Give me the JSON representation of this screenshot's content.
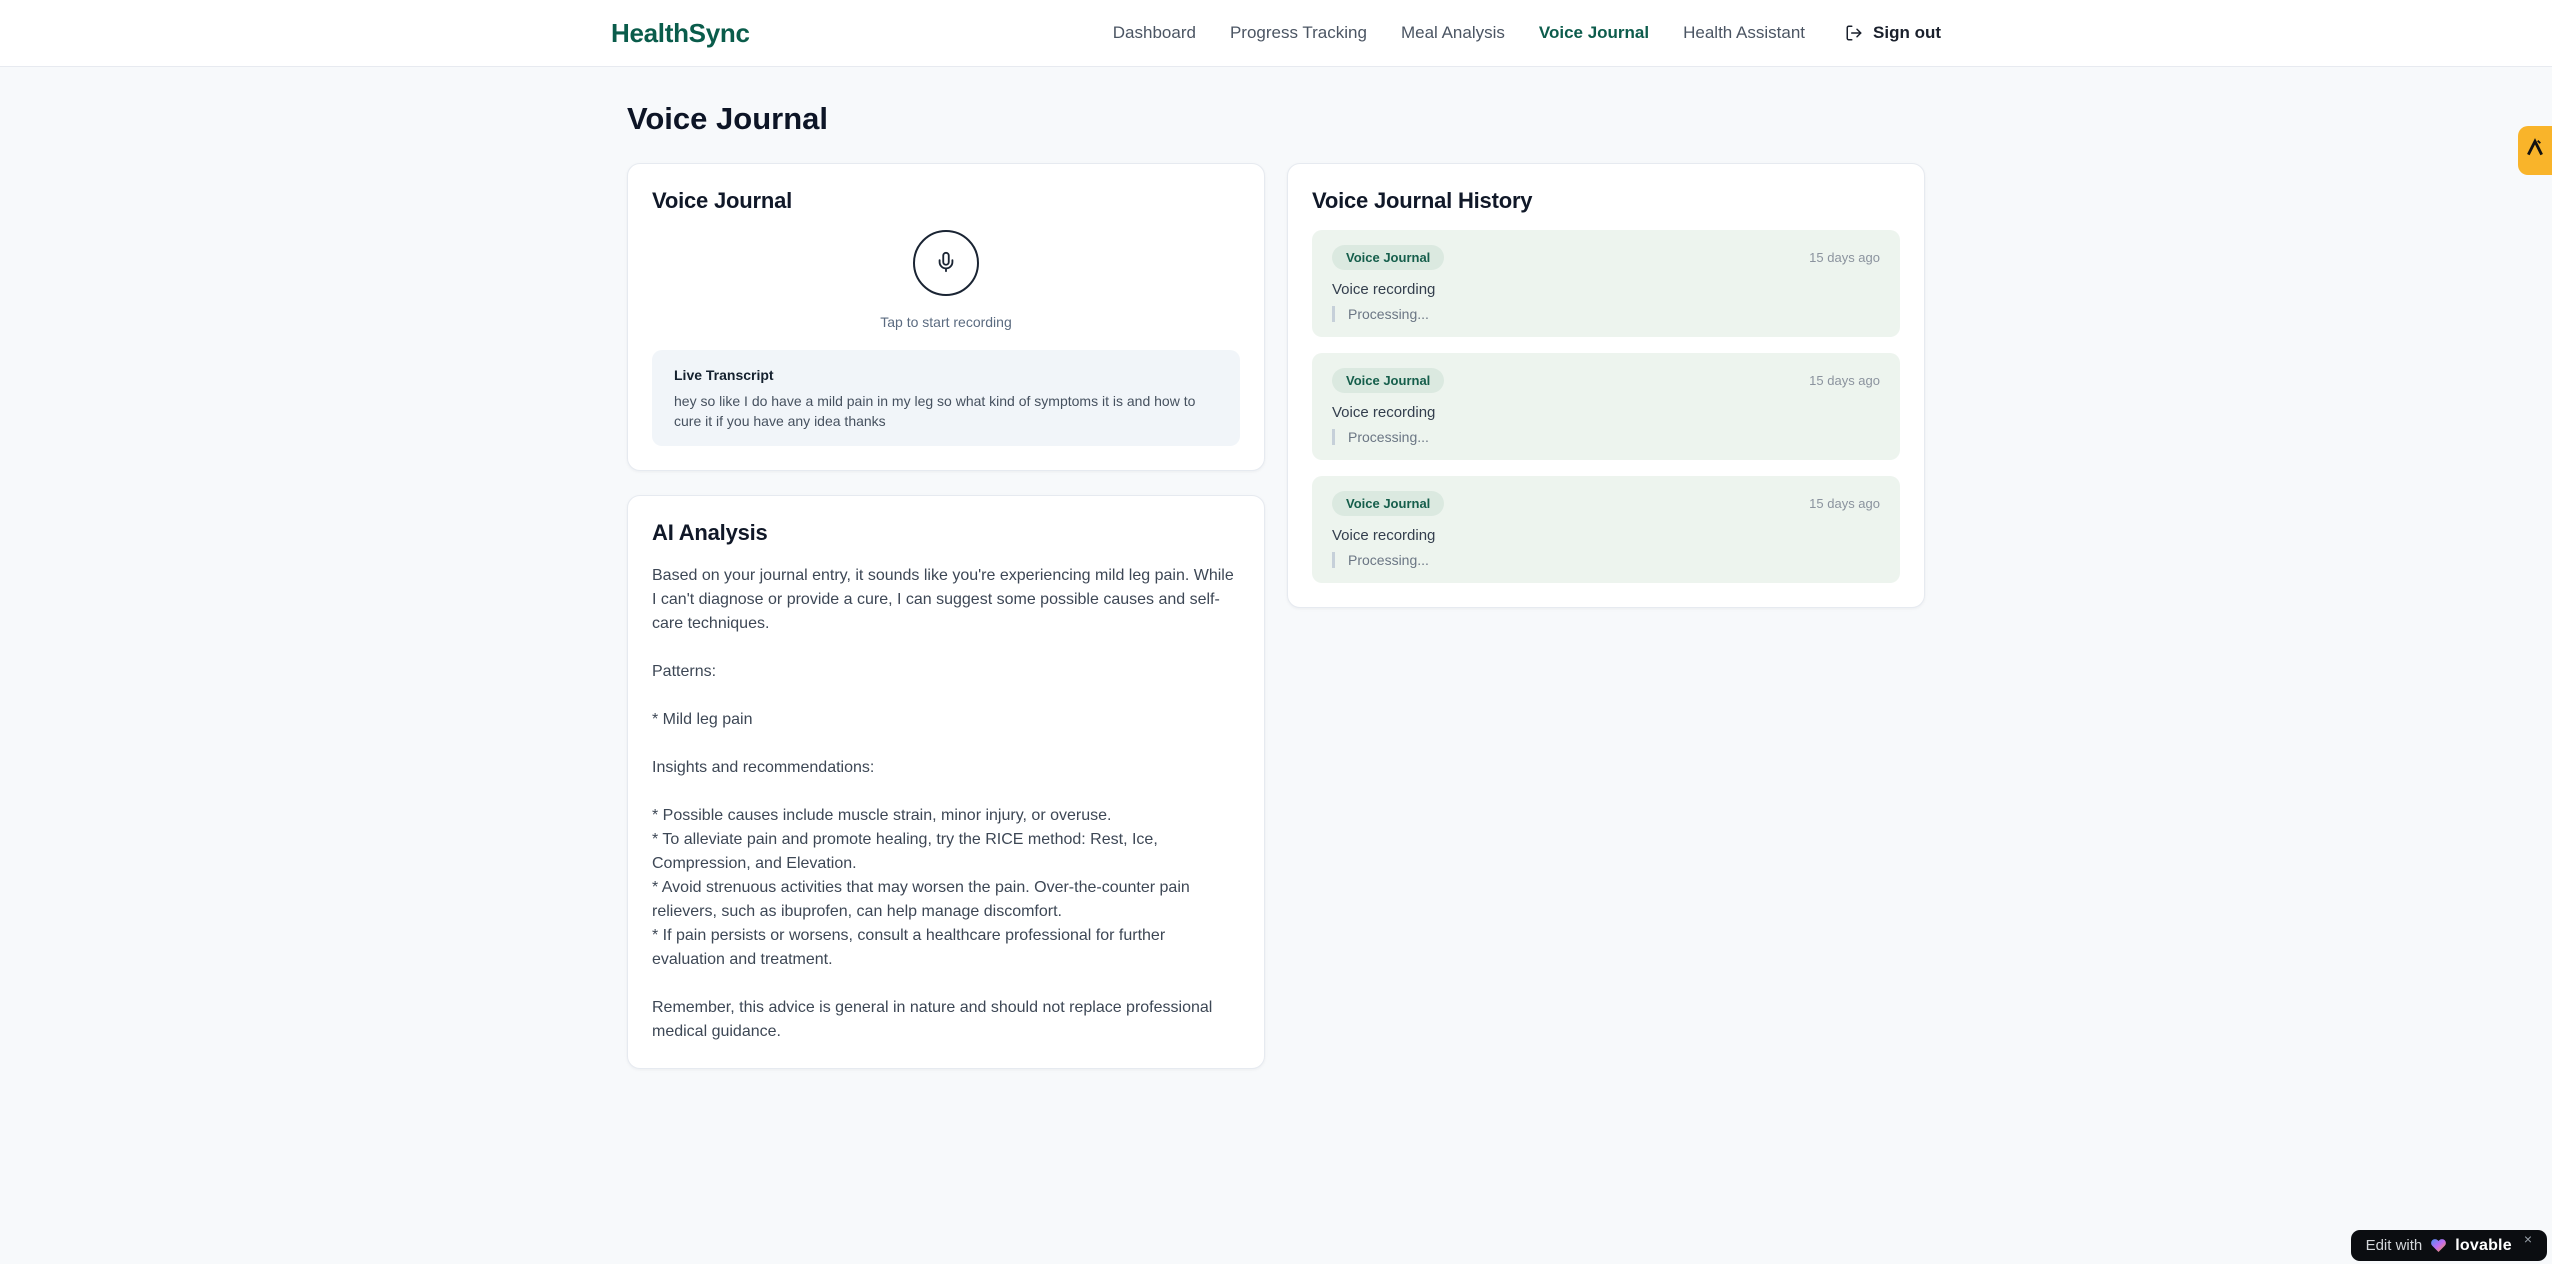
{
  "brand": {
    "name": "HealthSync"
  },
  "nav": {
    "items": [
      {
        "label": "Dashboard",
        "active": false
      },
      {
        "label": "Progress Tracking",
        "active": false
      },
      {
        "label": "Meal Analysis",
        "active": false
      },
      {
        "label": "Voice Journal",
        "active": true
      },
      {
        "label": "Health Assistant",
        "active": false
      }
    ],
    "sign_out": "Sign out"
  },
  "page": {
    "title": "Voice Journal"
  },
  "recorder": {
    "title": "Voice Journal",
    "hint": "Tap to start recording",
    "transcript_title": "Live Transcript",
    "transcript_text": "hey so like I do have a mild pain in my leg so what kind of symptoms it is and how to cure it if you have any idea thanks"
  },
  "analysis": {
    "title": "AI Analysis",
    "body": "Based on your journal entry, it sounds like you're experiencing mild leg pain. While I can't diagnose or provide a cure, I can suggest some possible causes and self-care techniques.\n\nPatterns:\n\n* Mild leg pain\n\nInsights and recommendations:\n\n* Possible causes include muscle strain, minor injury, or overuse.\n* To alleviate pain and promote healing, try the RICE method: Rest, Ice, Compression, and Elevation.\n* Avoid strenuous activities that may worsen the pain. Over-the-counter pain relievers, such as ibuprofen, can help manage discomfort.\n* If pain persists or worsens, consult a healthcare professional for further evaluation and treatment.\n\nRemember, this advice is general in nature and should not replace professional medical guidance."
  },
  "history": {
    "title": "Voice Journal History",
    "items": [
      {
        "badge": "Voice Journal",
        "time": "15 days ago",
        "label": "Voice recording",
        "status": "Processing..."
      },
      {
        "badge": "Voice Journal",
        "time": "15 days ago",
        "label": "Voice recording",
        "status": "Processing..."
      },
      {
        "badge": "Voice Journal",
        "time": "15 days ago",
        "label": "Voice recording",
        "status": "Processing..."
      }
    ]
  },
  "overlays": {
    "edit_badge": {
      "prefix": "Edit with",
      "brand": "lovable",
      "close": "×"
    }
  },
  "icons": {
    "logout": "log-out-arrow",
    "microphone": "mic",
    "side_tab": "anima-a-logo",
    "heart": "gradient-heart"
  },
  "colors": {
    "page_bg": "#f7f9fb",
    "brand_green": "#0a5c4b",
    "nav_active_green": "#0d5c4c",
    "history_item_bg": "#edf4ee",
    "badge_bg": "#dbe9e0",
    "badge_text": "#155e4b",
    "anima_yellow": "#f9b42a",
    "lovable_black": "#0b0d11"
  }
}
